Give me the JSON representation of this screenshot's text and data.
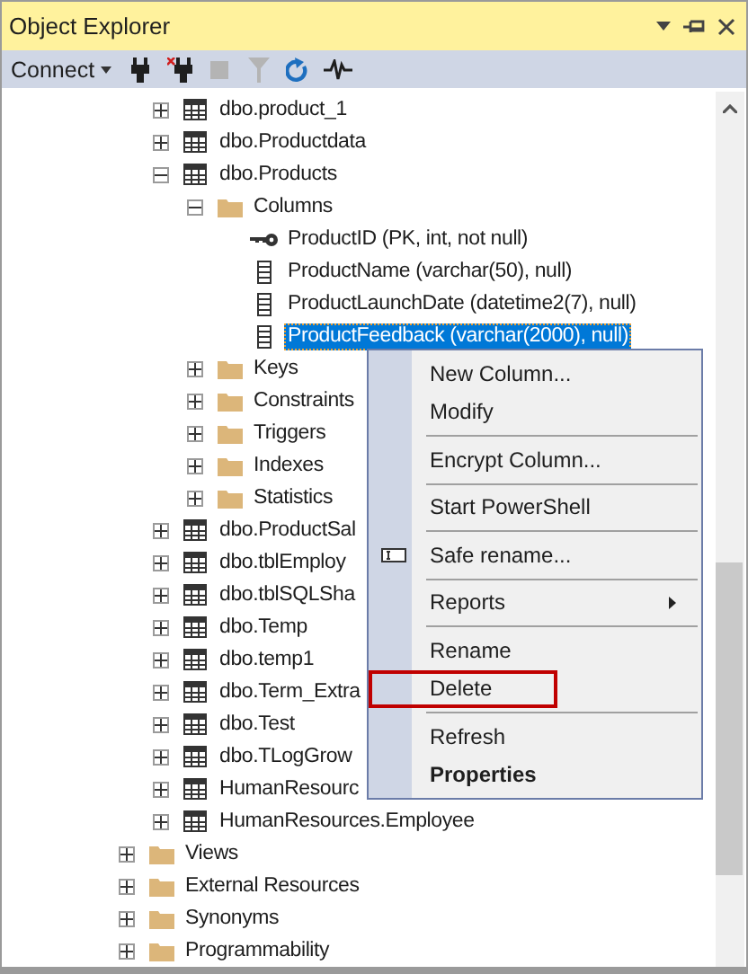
{
  "window": {
    "title": "Object Explorer"
  },
  "toolbar": {
    "connect_label": "Connect",
    "buttons": [
      {
        "kind": "connect",
        "disabled": false
      },
      {
        "kind": "disconnect",
        "disabled": false
      },
      {
        "kind": "stop",
        "disabled": true
      },
      {
        "kind": "filter",
        "disabled": true
      },
      {
        "kind": "refresh",
        "disabled": false
      },
      {
        "kind": "activity",
        "disabled": false
      }
    ]
  },
  "tree": {
    "continued_items": [
      {
        "text": "dbo.product_1",
        "kind": "table",
        "expanded": false,
        "selected": false
      },
      {
        "text": "dbo.Productdata",
        "kind": "table",
        "expanded": false,
        "selected": false
      },
      {
        "text": "dbo.Products",
        "kind": "table",
        "expanded": true,
        "selected": false,
        "children": [
          {
            "text": "Columns",
            "kind": "folder",
            "expanded": true,
            "selected": false,
            "children": [
              {
                "text": "ProductID (PK, int, not null)",
                "kind": "key",
                "selected": false
              },
              {
                "text": "ProductName (varchar(50), null)",
                "kind": "column",
                "selected": false
              },
              {
                "text": "ProductLaunchDate (datetime2(7), null)",
                "kind": "column",
                "selected": false
              },
              {
                "text": "ProductFeedback (varchar(2000), null)",
                "kind": "column",
                "selected": true
              }
            ]
          },
          {
            "text": "Keys",
            "kind": "folder",
            "expanded": false,
            "selected": false
          },
          {
            "text": "Constraints",
            "kind": "folder",
            "expanded": false,
            "selected": false
          },
          {
            "text": "Triggers",
            "kind": "folder",
            "expanded": false,
            "selected": false
          },
          {
            "text": "Indexes",
            "kind": "folder",
            "expanded": false,
            "selected": false
          },
          {
            "text": "Statistics",
            "kind": "folder",
            "expanded": false,
            "selected": false
          }
        ]
      },
      {
        "text": "dbo.ProductSal",
        "kind": "table",
        "expanded": false,
        "selected": false
      },
      {
        "text": "dbo.tblEmploy",
        "kind": "table",
        "expanded": false,
        "selected": false
      },
      {
        "text": "dbo.tblSQLSha",
        "kind": "table",
        "expanded": false,
        "selected": false
      },
      {
        "text": "dbo.Temp",
        "kind": "table",
        "expanded": false,
        "selected": false
      },
      {
        "text": "dbo.temp1",
        "kind": "table",
        "expanded": false,
        "selected": false
      },
      {
        "text": "dbo.Term_Extra",
        "kind": "table",
        "expanded": false,
        "selected": false
      },
      {
        "text": "dbo.Test",
        "kind": "table",
        "expanded": false,
        "selected": false
      },
      {
        "text": "dbo.TLogGrow",
        "kind": "table",
        "expanded": false,
        "selected": false
      },
      {
        "text": "HumanResourc",
        "kind": "table",
        "expanded": false,
        "selected": false
      },
      {
        "text": "HumanResources.Employee",
        "kind": "table",
        "expanded": false,
        "selected": false
      }
    ],
    "items": [
      {
        "text": "Views",
        "kind": "folder",
        "expanded": false,
        "selected": false
      },
      {
        "text": "External Resources",
        "kind": "folder",
        "expanded": false,
        "selected": false
      },
      {
        "text": "Synonyms",
        "kind": "folder",
        "expanded": false,
        "selected": false
      },
      {
        "text": "Programmability",
        "kind": "folder",
        "expanded": false,
        "selected": false
      }
    ]
  },
  "context_menu": [
    {
      "kind": "item",
      "label": "New Column...",
      "highlighted": false,
      "default": false
    },
    {
      "kind": "item",
      "label": "Modify",
      "highlighted": false,
      "default": false
    },
    {
      "kind": "separator"
    },
    {
      "kind": "item",
      "label": "Encrypt Column...",
      "highlighted": false,
      "default": false
    },
    {
      "kind": "separator"
    },
    {
      "kind": "item",
      "label": "Start PowerShell",
      "highlighted": false,
      "default": false
    },
    {
      "kind": "separator"
    },
    {
      "kind": "icon_item",
      "label": "Safe rename...",
      "highlighted": false,
      "default": false
    },
    {
      "kind": "separator"
    },
    {
      "kind": "submenu",
      "label": "Reports",
      "highlighted": false,
      "default": false
    },
    {
      "kind": "separator"
    },
    {
      "kind": "item",
      "label": "Rename",
      "highlighted": false,
      "default": false
    },
    {
      "kind": "item",
      "label": "Delete",
      "highlighted": true,
      "default": false
    },
    {
      "kind": "separator"
    },
    {
      "kind": "item",
      "label": "Refresh",
      "highlighted": false,
      "default": false
    },
    {
      "kind": "item",
      "label": "Properties",
      "highlighted": false,
      "default": true
    }
  ]
}
